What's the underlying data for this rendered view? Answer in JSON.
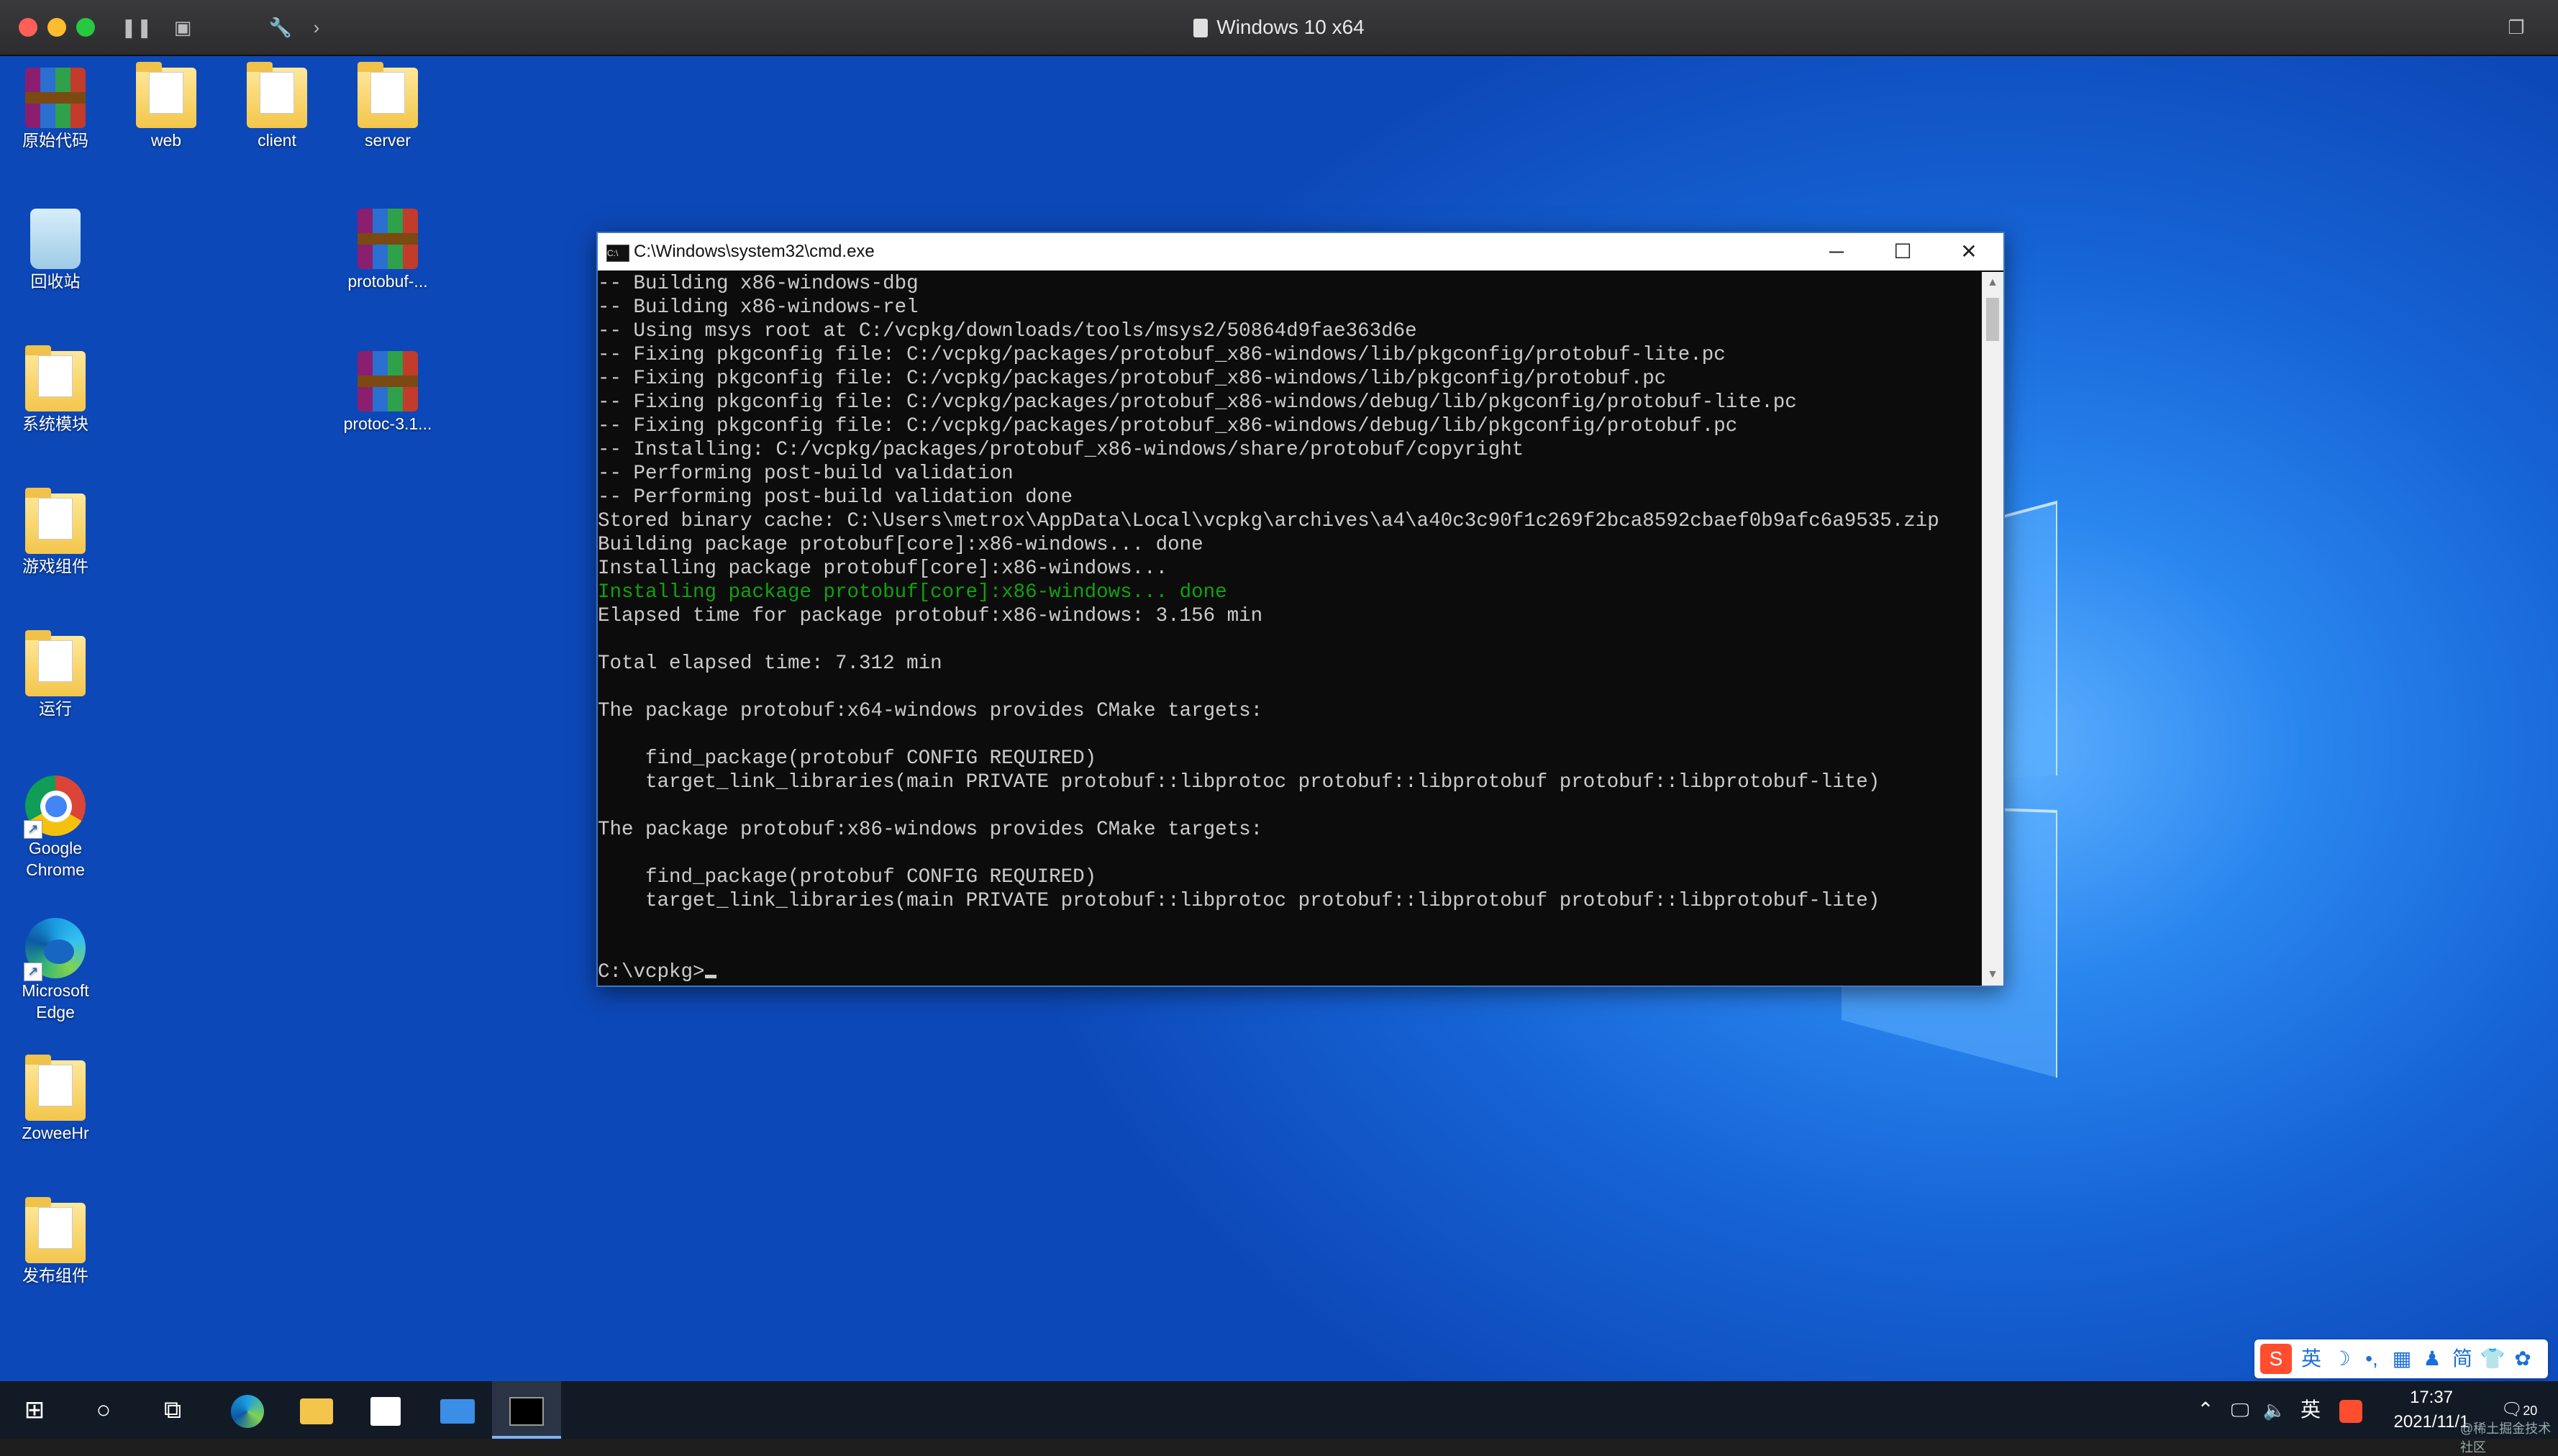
{
  "host": {
    "title": "Windows 10 x64"
  },
  "desktop_icons": [
    {
      "label": "原始代码"
    },
    {
      "label": "web"
    },
    {
      "label": "client"
    },
    {
      "label": "server"
    },
    {
      "label": "回收站"
    },
    {
      "label": "protobuf-..."
    },
    {
      "label": "系统模块"
    },
    {
      "label": "protoc-3.1..."
    },
    {
      "label": "游戏组件"
    },
    {
      "label": "运行"
    },
    {
      "label": "Google Chrome"
    },
    {
      "label": "Microsoft Edge"
    },
    {
      "label": "ZoweeHr"
    },
    {
      "label": "发布组件"
    }
  ],
  "cmd": {
    "title": "C:\\Windows\\system32\\cmd.exe",
    "lines": [
      "-- Building x86-windows-dbg",
      "-- Building x86-windows-rel",
      "-- Using msys root at C:/vcpkg/downloads/tools/msys2/50864d9fae363d6e",
      "-- Fixing pkgconfig file: C:/vcpkg/packages/protobuf_x86-windows/lib/pkgconfig/protobuf-lite.pc",
      "-- Fixing pkgconfig file: C:/vcpkg/packages/protobuf_x86-windows/lib/pkgconfig/protobuf.pc",
      "-- Fixing pkgconfig file: C:/vcpkg/packages/protobuf_x86-windows/debug/lib/pkgconfig/protobuf-lite.pc",
      "-- Fixing pkgconfig file: C:/vcpkg/packages/protobuf_x86-windows/debug/lib/pkgconfig/protobuf.pc",
      "-- Installing: C:/vcpkg/packages/protobuf_x86-windows/share/protobuf/copyright",
      "-- Performing post-build validation",
      "-- Performing post-build validation done",
      "Stored binary cache: C:\\Users\\metrox\\AppData\\Local\\vcpkg\\archives\\a4\\a40c3c90f1c269f2bca8592cbaef0b9afc6a9535.zip",
      "Building package protobuf[core]:x86-windows... done",
      "Installing package protobuf[core]:x86-windows...",
      "Installing package protobuf[core]:x86-windows... done",
      "Elapsed time for package protobuf:x86-windows: 3.156 min",
      "",
      "Total elapsed time: 7.312 min",
      "",
      "The package protobuf:x64-windows provides CMake targets:",
      "",
      "    find_package(protobuf CONFIG REQUIRED)",
      "    target_link_libraries(main PRIVATE protobuf::libprotoc protobuf::libprotobuf protobuf::libprotobuf-lite)",
      "",
      "The package protobuf:x86-windows provides CMake targets:",
      "",
      "    find_package(protobuf CONFIG REQUIRED)",
      "    target_link_libraries(main PRIVATE protobuf::libprotoc protobuf::libprotobuf protobuf::libprotobuf-lite)",
      "",
      "",
      "C:\\vcpkg>"
    ],
    "highlight_line_index": 13,
    "highlight_color": "#13a10e"
  },
  "ime_bar": {
    "lang": "英",
    "punct": "'，",
    "moon": "☽",
    "settings": "⚙"
  },
  "sogou_bar": {
    "lang": "英",
    "items": [
      "☽",
      "•,",
      "▦",
      "♟",
      "简",
      "👕",
      "✿"
    ]
  },
  "tray": {
    "lang": "英",
    "time": "17:37",
    "date": "2021/11/1",
    "notif_count": "20",
    "watermark": "@稀土掘金技术社区"
  },
  "taskbar_apps": [
    "start-icon",
    "cortana-icon",
    "task-view-icon",
    "edge-icon",
    "file-explorer-icon",
    "store-icon",
    "mail-icon",
    "cmd-icon"
  ]
}
